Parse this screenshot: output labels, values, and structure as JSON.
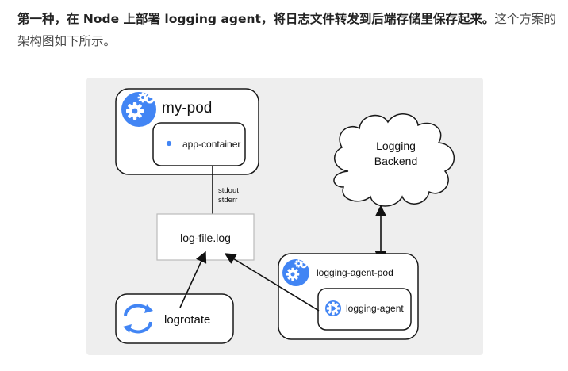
{
  "paragraph": {
    "strong": "第一种，在 Node 上部署 logging agent，将日志文件转发到后端存储里保存起来。",
    "rest": "这个方案的架构图如下所示。"
  },
  "diagram": {
    "my_pod": "my-pod",
    "app_container": "app-container",
    "stdout": "stdout",
    "stderr": "stderr",
    "log_file": "log-file.log",
    "logrotate": "logrotate",
    "backend_line1": "Logging",
    "backend_line2": "Backend",
    "agent_pod": "logging-agent-pod",
    "agent": "logging-agent"
  },
  "colors": {
    "diagram_bg": "#eeeeee",
    "icon_blue": "#4285f4",
    "box_stroke": "#1a1a1a"
  }
}
